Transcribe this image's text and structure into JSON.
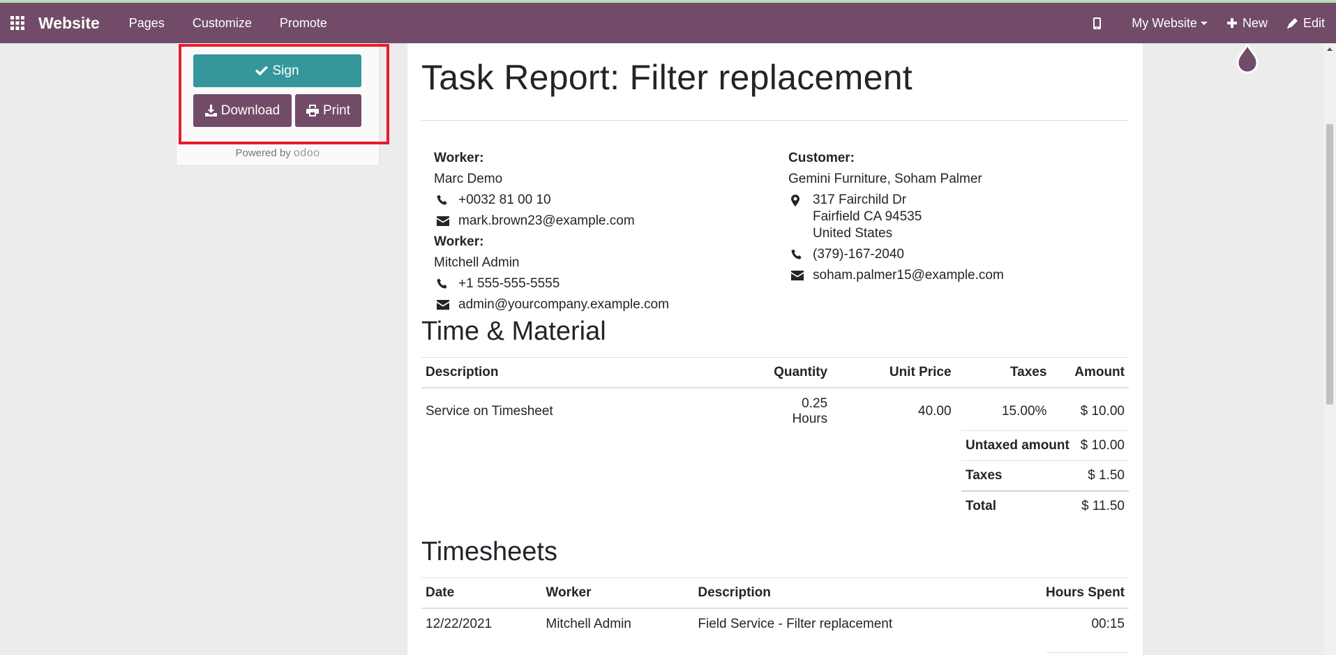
{
  "navbar": {
    "brand": "Website",
    "menu": [
      "Pages",
      "Customize",
      "Promote"
    ],
    "website_selector": "My Website",
    "new_label": "New",
    "edit_label": "Edit",
    "bg_color": "#714b67"
  },
  "sidebar": {
    "sign_label": "Sign",
    "download_label": "Download",
    "print_label": "Print",
    "powered_by": "Powered by",
    "powered_logo": "odoo",
    "sign_color": "#35979c"
  },
  "report": {
    "title": "Task Report: Filter replacement",
    "workers": [
      {
        "label": "Worker:",
        "name": "Marc Demo",
        "phone": "+0032 81 00 10",
        "email": "mark.brown23@example.com"
      },
      {
        "label": "Worker:",
        "name": "Mitchell Admin",
        "phone": "+1 555-555-5555",
        "email": "admin@yourcompany.example.com"
      }
    ],
    "customer": {
      "label": "Customer:",
      "name": "Gemini Furniture, Soham Palmer",
      "address_lines": [
        "317 Fairchild Dr",
        "Fairfield CA 94535",
        "United States"
      ],
      "phone": "(379)-167-2040",
      "email": "soham.palmer15@example.com"
    },
    "time_material": {
      "title": "Time & Material",
      "headers": [
        "Description",
        "Quantity",
        "Unit Price",
        "Taxes",
        "Amount"
      ],
      "rows": [
        {
          "description": "Service on Timesheet",
          "quantity": "0.25 Hours",
          "unit_price": "40.00",
          "taxes": "15.00%",
          "amount": "$ 10.00"
        }
      ],
      "totals": [
        {
          "label": "Untaxed amount",
          "value": "$ 10.00"
        },
        {
          "label": "Taxes",
          "value": "$ 1.50"
        },
        {
          "label": "Total",
          "value": "$ 11.50"
        }
      ]
    },
    "timesheets": {
      "title": "Timesheets",
      "headers": [
        "Date",
        "Worker",
        "Description",
        "Hours Spent"
      ],
      "rows": [
        {
          "date": "12/22/2021",
          "worker": "Mitchell Admin",
          "description": "Field Service - Filter replacement",
          "hours": "00:15"
        }
      ]
    }
  }
}
